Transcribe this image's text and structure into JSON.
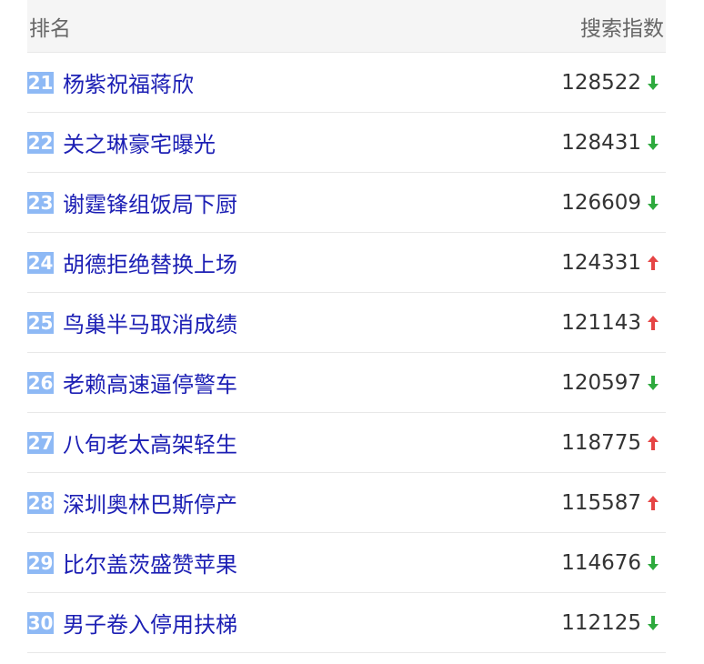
{
  "header": {
    "rank_label": "排名",
    "index_label": "搜索指数"
  },
  "colors": {
    "badge": "#8eb9f5",
    "keyword": "#1c1fb4",
    "up": "#e64545",
    "down": "#2eaa3e"
  },
  "rows": [
    {
      "rank": "21",
      "keyword": "杨紫祝福蒋欣",
      "value": "128522",
      "trend": "down",
      "trend_icon": "arrow-down-icon"
    },
    {
      "rank": "22",
      "keyword": "关之琳豪宅曝光",
      "value": "128431",
      "trend": "down",
      "trend_icon": "arrow-down-icon"
    },
    {
      "rank": "23",
      "keyword": "谢霆锋组饭局下厨",
      "value": "126609",
      "trend": "down",
      "trend_icon": "arrow-down-icon"
    },
    {
      "rank": "24",
      "keyword": "胡德拒绝替换上场",
      "value": "124331",
      "trend": "up",
      "trend_icon": "arrow-up-icon"
    },
    {
      "rank": "25",
      "keyword": "鸟巢半马取消成绩",
      "value": "121143",
      "trend": "up",
      "trend_icon": "arrow-up-icon"
    },
    {
      "rank": "26",
      "keyword": "老赖高速逼停警车",
      "value": "120597",
      "trend": "down",
      "trend_icon": "arrow-down-icon"
    },
    {
      "rank": "27",
      "keyword": "八旬老太高架轻生",
      "value": "118775",
      "trend": "up",
      "trend_icon": "arrow-up-icon"
    },
    {
      "rank": "28",
      "keyword": "深圳奥林巴斯停产",
      "value": "115587",
      "trend": "up",
      "trend_icon": "arrow-up-icon"
    },
    {
      "rank": "29",
      "keyword": "比尔盖茨盛赞苹果",
      "value": "114676",
      "trend": "down",
      "trend_icon": "arrow-down-icon"
    },
    {
      "rank": "30",
      "keyword": "男子卷入停用扶梯",
      "value": "112125",
      "trend": "down",
      "trend_icon": "arrow-down-icon"
    }
  ]
}
